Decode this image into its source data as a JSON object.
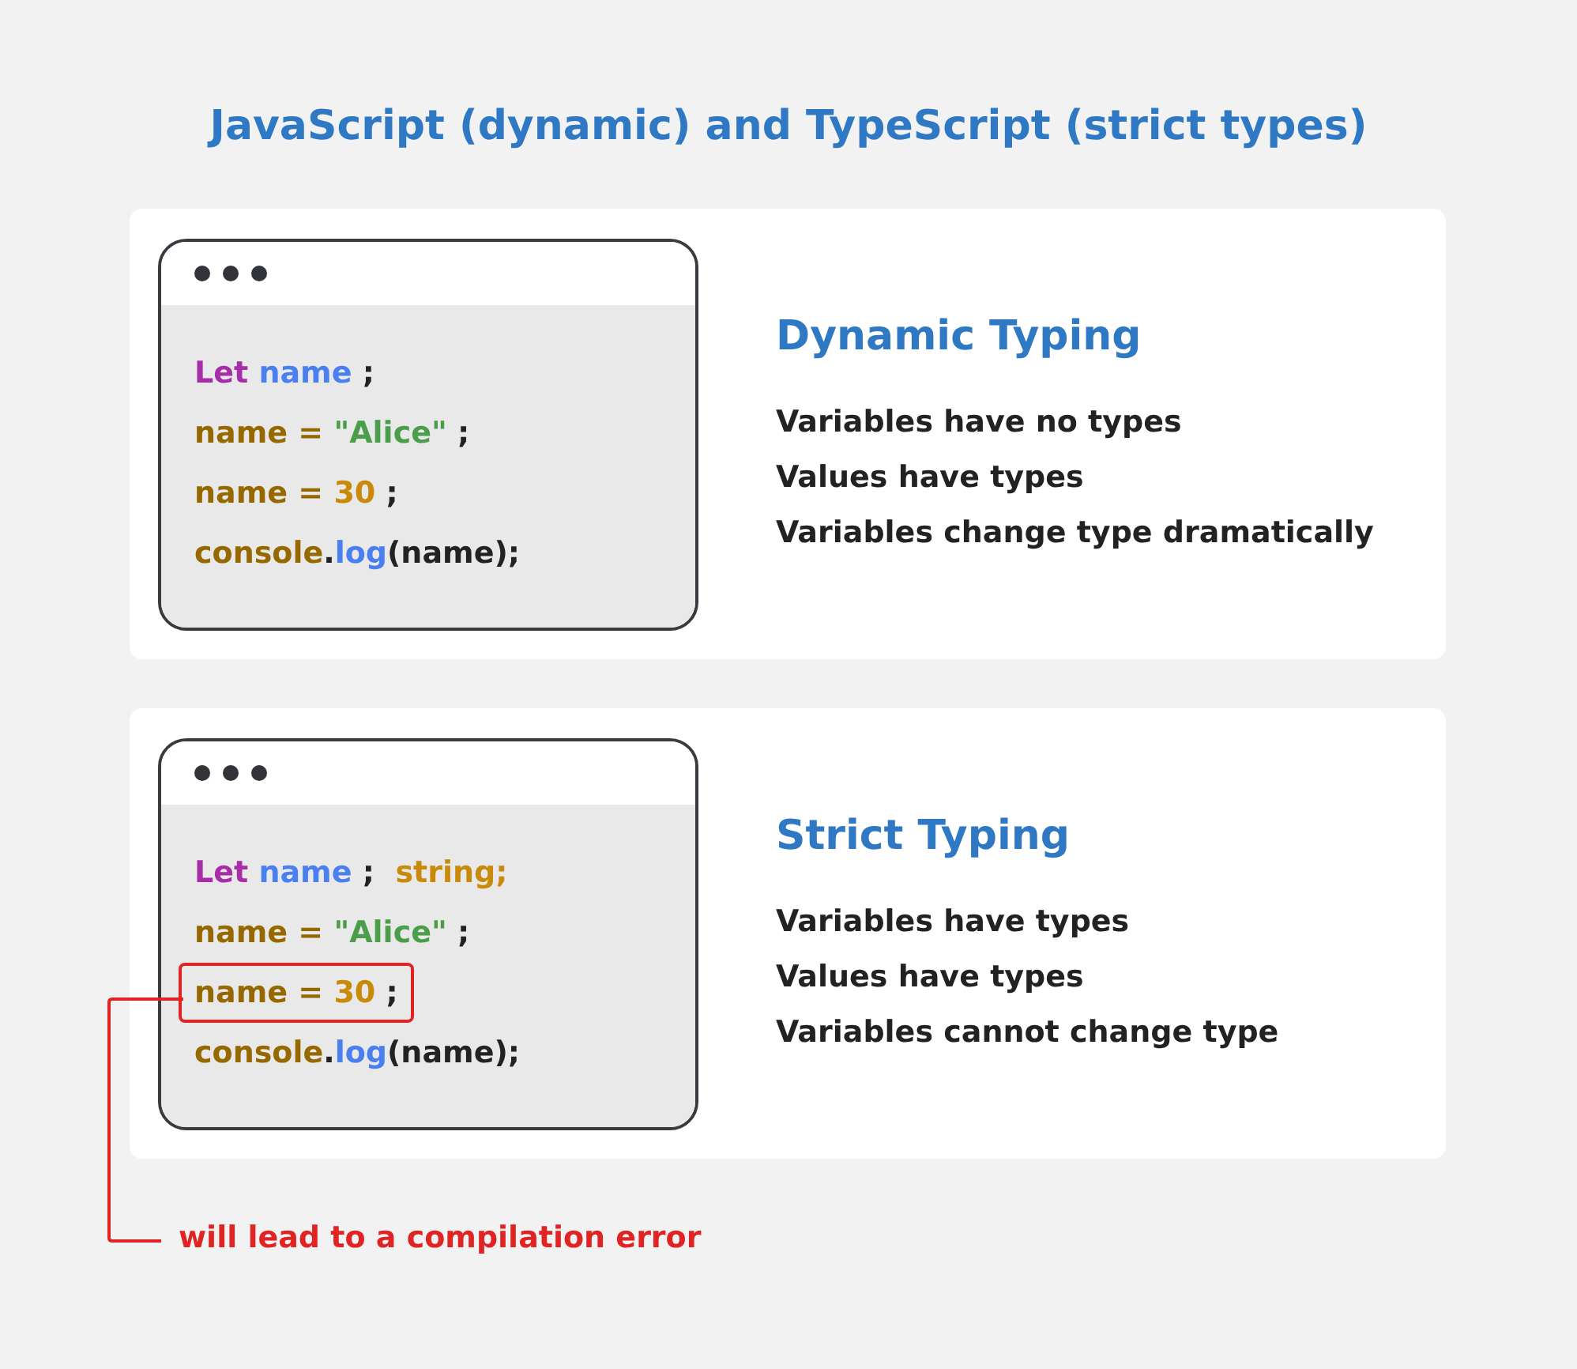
{
  "title": "JavaScript (dynamic) and TypeScript (strict types)",
  "panels": [
    {
      "code_window": {
        "lines": [
          {
            "highlighted": false,
            "tokens": [
              {
                "kind": "keyword",
                "text": "Let "
              },
              {
                "kind": "identifier",
                "text": "name "
              },
              {
                "kind": "punct",
                "text": ";"
              }
            ]
          },
          {
            "highlighted": false,
            "tokens": [
              {
                "kind": "variable",
                "text": "name = "
              },
              {
                "kind": "string",
                "text": "\"Alice\" "
              },
              {
                "kind": "punct",
                "text": ";"
              }
            ]
          },
          {
            "highlighted": false,
            "tokens": [
              {
                "kind": "variable",
                "text": "name = "
              },
              {
                "kind": "number",
                "text": "30 "
              },
              {
                "kind": "punct",
                "text": ";"
              }
            ]
          },
          {
            "highlighted": false,
            "tokens": [
              {
                "kind": "variable",
                "text": "console"
              },
              {
                "kind": "punct",
                "text": "."
              },
              {
                "kind": "identifier",
                "text": "log"
              },
              {
                "kind": "punct",
                "text": "(name);"
              }
            ]
          }
        ]
      },
      "heading": "Dynamic Typing",
      "points": [
        "Variables have no types",
        "Values have types",
        "Variables change type dramatically"
      ]
    },
    {
      "code_window": {
        "lines": [
          {
            "highlighted": false,
            "tokens": [
              {
                "kind": "keyword",
                "text": "Let "
              },
              {
                "kind": "identifier",
                "text": "name "
              },
              {
                "kind": "punct",
                "text": ";  "
              },
              {
                "kind": "type",
                "text": "string;"
              }
            ]
          },
          {
            "highlighted": false,
            "tokens": [
              {
                "kind": "variable",
                "text": "name = "
              },
              {
                "kind": "string",
                "text": "\"Alice\" "
              },
              {
                "kind": "punct",
                "text": ";"
              }
            ]
          },
          {
            "highlighted": true,
            "tokens": [
              {
                "kind": "variable",
                "text": "name = "
              },
              {
                "kind": "number",
                "text": "30 "
              },
              {
                "kind": "punct",
                "text": ";"
              }
            ]
          },
          {
            "highlighted": false,
            "tokens": [
              {
                "kind": "variable",
                "text": "console"
              },
              {
                "kind": "punct",
                "text": "."
              },
              {
                "kind": "identifier",
                "text": "log"
              },
              {
                "kind": "punct",
                "text": "(name);"
              }
            ]
          }
        ]
      },
      "heading": "Strict Typing",
      "points": [
        "Variables have types",
        "Values have types",
        "Variables cannot change type"
      ]
    }
  ],
  "note": "will lead to a compilation error"
}
